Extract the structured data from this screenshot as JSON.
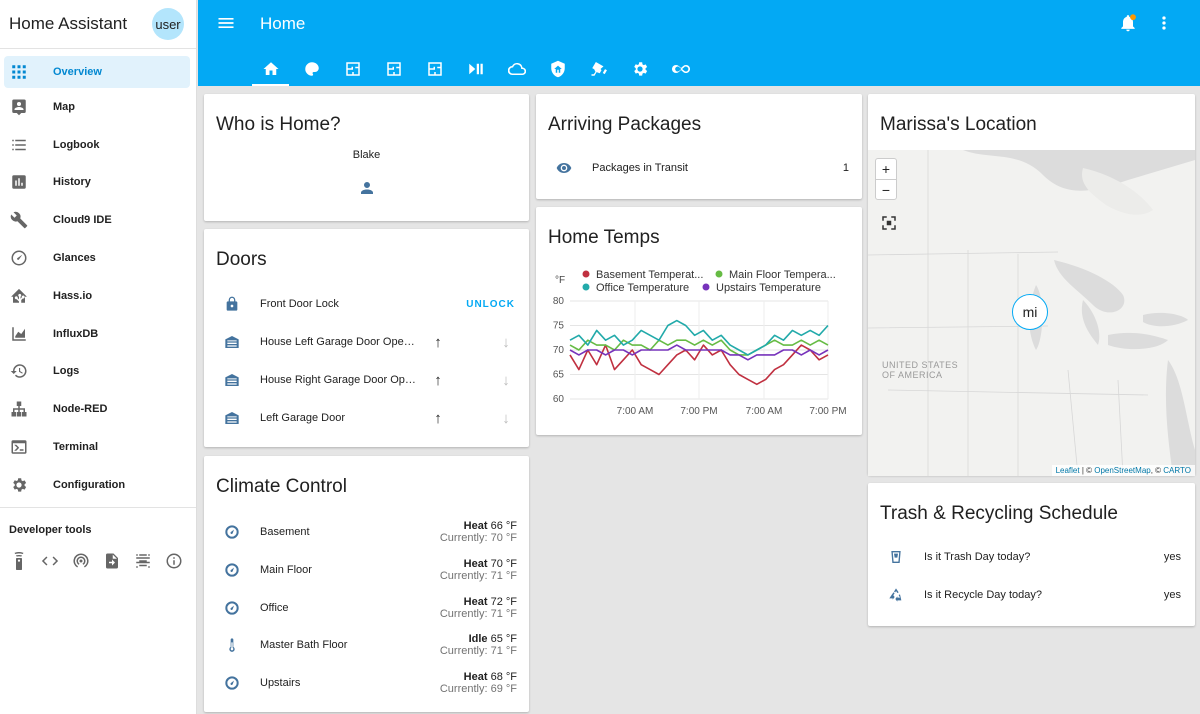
{
  "sidebar": {
    "title": "Home Assistant",
    "avatar": "user",
    "items": [
      {
        "label": "Overview",
        "icon": "grid-icon"
      },
      {
        "label": "Map",
        "icon": "map-person-icon"
      },
      {
        "label": "Logbook",
        "icon": "list-icon"
      },
      {
        "label": "History",
        "icon": "chart-icon"
      },
      {
        "label": "Cloud9 IDE",
        "icon": "wrench-icon"
      },
      {
        "label": "Glances",
        "icon": "gauge-icon"
      },
      {
        "label": "Hass.io",
        "icon": "home-assistant-icon"
      },
      {
        "label": "InfluxDB",
        "icon": "area-chart-icon"
      },
      {
        "label": "Logs",
        "icon": "history-icon"
      },
      {
        "label": "Node-RED",
        "icon": "sitemap-icon"
      },
      {
        "label": "Terminal",
        "icon": "console-icon"
      },
      {
        "label": "Configuration",
        "icon": "gear-icon"
      }
    ],
    "dev_tools_label": "Developer tools"
  },
  "header": {
    "title": "Home"
  },
  "cards": {
    "who": {
      "title": "Who is Home?",
      "person": "Blake"
    },
    "doors": {
      "title": "Doors",
      "lock": {
        "label": "Front Door Lock",
        "action": "UNLOCK"
      },
      "covers": [
        {
          "label": "House Left Garage Door Opener"
        },
        {
          "label": "House Right Garage Door Opener"
        },
        {
          "label": "Left Garage Door"
        }
      ]
    },
    "climate": {
      "title": "Climate Control",
      "items": [
        {
          "label": "Basement",
          "mode": "Heat",
          "target": "66 °F",
          "current": "Currently: 70 °F"
        },
        {
          "label": "Main Floor",
          "mode": "Heat",
          "target": "70 °F",
          "current": "Currently: 71 °F"
        },
        {
          "label": "Office",
          "mode": "Heat",
          "target": "72 °F",
          "current": "Currently: 71 °F"
        },
        {
          "label": "Master Bath Floor",
          "mode": "Idle",
          "target": "65 °F",
          "current": "Currently: 71 °F"
        },
        {
          "label": "Upstairs",
          "mode": "Heat",
          "target": "68 °F",
          "current": "Currently: 69 °F"
        }
      ]
    },
    "packages": {
      "title": "Arriving Packages",
      "label": "Packages in Transit",
      "value": "1"
    },
    "temps": {
      "title": "Home Temps"
    },
    "location": {
      "title": "Marissa's Location",
      "marker": "mi",
      "map_label": "UNITED STATES\nOF AMERICA",
      "attribution_leaflet": "Leaflet",
      "attribution_rest": " | © ",
      "attribution_osm": "OpenStreetMap",
      "attribution_sep": ", © ",
      "attribution_carto": "CARTO"
    },
    "trash": {
      "title": "Trash & Recycling Schedule",
      "items": [
        {
          "label": "Is it Trash Day today?",
          "value": "yes"
        },
        {
          "label": "Is it Recycle Day today?",
          "value": "yes"
        }
      ]
    }
  },
  "colors": {
    "primary": "#03a9f4",
    "basement": "#c03040",
    "main_floor": "#66bb44",
    "office": "#22aaaa",
    "upstairs": "#7733bb"
  },
  "chart_data": {
    "type": "line",
    "ylabel": "°F",
    "ylim": [
      60,
      80
    ],
    "yticks": [
      "80",
      "75",
      "70",
      "65",
      "60"
    ],
    "xticks": [
      "7:00 AM",
      "7:00 PM",
      "7:00 AM",
      "7:00 PM"
    ],
    "legend": [
      "Basement Temperat...",
      "Main Floor Tempera...",
      "Office Temperature",
      "Upstairs Temperature"
    ],
    "series": [
      {
        "name": "Basement Temperature",
        "color": "#c03040",
        "values": [
          69,
          66,
          70,
          67,
          71,
          66,
          68,
          70,
          67,
          66,
          65,
          67,
          69,
          70,
          68,
          71,
          69,
          70,
          67,
          65,
          64,
          63,
          64,
          66,
          67,
          69,
          71,
          70,
          68,
          69
        ]
      },
      {
        "name": "Main Floor Temperature",
        "color": "#66bb44",
        "values": [
          71,
          70,
          72,
          71,
          71,
          70,
          72,
          71,
          71,
          70,
          72,
          71,
          72,
          72,
          71,
          72,
          71,
          72,
          70,
          69,
          69,
          70,
          71,
          72,
          71,
          71,
          72,
          71,
          72,
          71
        ]
      },
      {
        "name": "Office Temperature",
        "color": "#22aaaa",
        "values": [
          72,
          73,
          71,
          74,
          72,
          73,
          71,
          72,
          74,
          73,
          72,
          75,
          76,
          75,
          73,
          74,
          72,
          73,
          71,
          70,
          69,
          70,
          71,
          73,
          72,
          74,
          73,
          74,
          73,
          75
        ]
      },
      {
        "name": "Upstairs Temperature",
        "color": "#7733bb",
        "values": [
          70,
          69,
          70,
          70,
          69,
          70,
          70,
          69,
          70,
          70,
          70,
          70,
          71,
          70,
          70,
          70,
          70,
          70,
          69,
          69,
          68,
          69,
          69,
          69,
          70,
          70,
          69,
          70,
          69,
          70
        ]
      }
    ]
  }
}
